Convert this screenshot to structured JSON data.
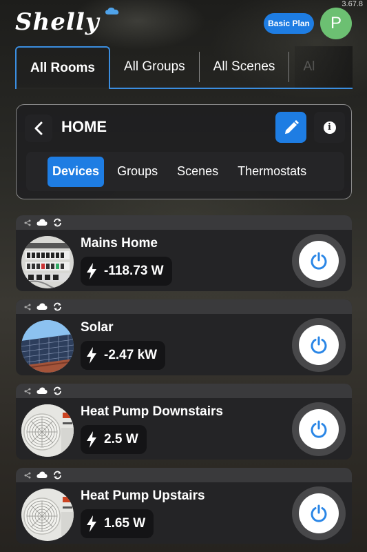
{
  "app": {
    "version": "3.67.8",
    "logo_text": "Shelly",
    "plan_label": "Basic Plan",
    "avatar_initial": "P"
  },
  "tabs": [
    {
      "label": "All Rooms",
      "active": true
    },
    {
      "label": "All Groups",
      "active": false
    },
    {
      "label": "All Scenes",
      "active": false
    },
    {
      "label": "Al",
      "active": false
    }
  ],
  "room": {
    "title": "HOME",
    "subtabs": [
      {
        "label": "Devices",
        "active": true
      },
      {
        "label": "Groups",
        "active": false
      },
      {
        "label": "Scenes",
        "active": false
      },
      {
        "label": "Thermostats",
        "active": false
      }
    ]
  },
  "devices": [
    {
      "name": "Mains Home",
      "power": "-118.73 W",
      "image": "electrical-panel"
    },
    {
      "name": "Solar",
      "power": "-2.47 kW",
      "image": "solar-panels"
    },
    {
      "name": "Heat Pump Downstairs",
      "power": "2.5 W",
      "image": "heat-pump"
    },
    {
      "name": "Heat Pump Upstairs",
      "power": "1.65 W",
      "image": "heat-pump"
    }
  ],
  "colors": {
    "accent": "#1e7de3",
    "avatar": "#6cc072"
  }
}
